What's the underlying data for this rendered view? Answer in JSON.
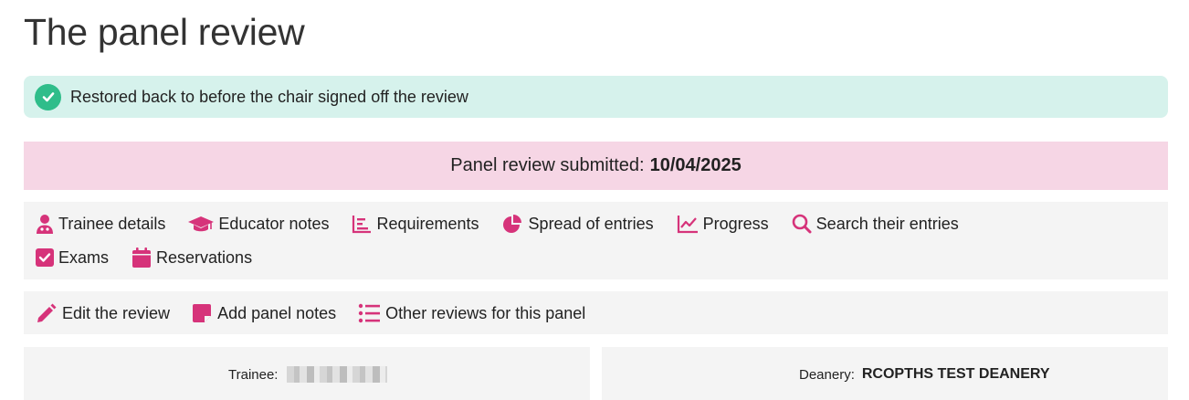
{
  "page": {
    "title": "The panel review"
  },
  "alert": {
    "message": "Restored back to before the chair signed off the review",
    "icon": "check-circle-icon",
    "color": "#2fbd8a"
  },
  "banner": {
    "label": "Panel review submitted:",
    "date": "10/04/2025"
  },
  "nav": {
    "row1": [
      {
        "label": "Trainee details",
        "icon": "user-doctor-icon"
      },
      {
        "label": "Educator notes",
        "icon": "graduation-cap-icon"
      },
      {
        "label": "Requirements",
        "icon": "bar-chart-icon"
      },
      {
        "label": "Spread of entries",
        "icon": "pie-chart-icon"
      },
      {
        "label": "Progress",
        "icon": "line-chart-icon"
      },
      {
        "label": "Search their entries",
        "icon": "search-icon"
      }
    ],
    "row2": [
      {
        "label": "Exams",
        "icon": "checkbox-icon"
      },
      {
        "label": "Reservations",
        "icon": "calendar-icon"
      }
    ]
  },
  "actions": [
    {
      "label": "Edit the review",
      "icon": "pencil-icon"
    },
    {
      "label": "Add panel notes",
      "icon": "note-icon"
    },
    {
      "label": "Other reviews for this panel",
      "icon": "list-icon"
    }
  ],
  "details": {
    "trainee_label": "Trainee:",
    "deanery_label": "Deanery:",
    "deanery_value": "RCOPTHS TEST DEANERY"
  },
  "colors": {
    "accent": "#d6337a",
    "alert_bg": "#d6f2ec",
    "banner_bg": "#f6d6e5",
    "panel_bg": "#f4f4f4"
  }
}
